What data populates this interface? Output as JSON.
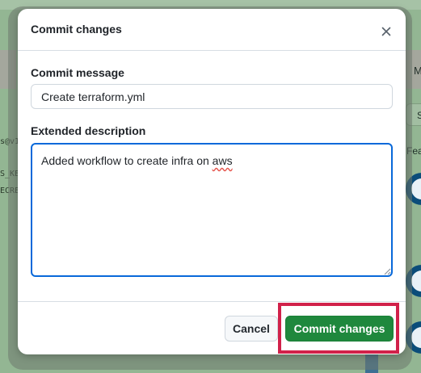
{
  "background": {
    "left_lines": [
      "s@v1",
      "S_KE",
      "ECRE"
    ],
    "right_tab": "M",
    "right_input": "S",
    "right_label": "Fea"
  },
  "modal": {
    "title": "Commit changes",
    "close_icon": "close-icon",
    "commit_message_label": "Commit message",
    "commit_message_value": "Create terraform.yml",
    "extended_description_label": "Extended description",
    "extended_description_text": "Added workflow to create infra on ",
    "extended_description_typo": "aws",
    "cancel_label": "Cancel",
    "commit_label": "Commit changes"
  },
  "colors": {
    "primary_button": "#1f883d",
    "focus_border": "#0969da",
    "highlight": "#d1214a"
  }
}
